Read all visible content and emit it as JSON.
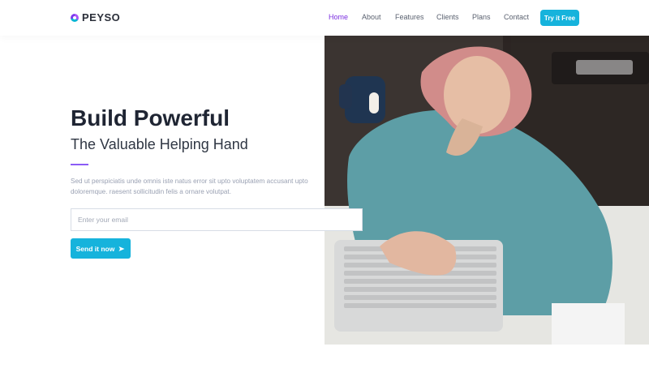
{
  "header": {
    "brand": "PEYSO",
    "nav": [
      {
        "label": "Home",
        "active": true
      },
      {
        "label": "About",
        "active": false
      },
      {
        "label": "Features",
        "active": false
      },
      {
        "label": "Clients",
        "active": false
      },
      {
        "label": "Plans",
        "active": false
      },
      {
        "label": "Contact",
        "active": false
      }
    ],
    "cta_label": "Try it Free"
  },
  "hero": {
    "title": "Build Powerful",
    "subtitle": "The Valuable Helping Hand",
    "description": "Sed ut perspiciatis unde omnis iste natus error sit upto voluptatem accusant upto doloremque. raesent sollicitudin felis a ornare volutpat.",
    "email_placeholder": "Enter your email",
    "email_value": "",
    "send_label": "Send it now"
  },
  "colors": {
    "accent": "#7b2fe0",
    "button": "#16b3dc",
    "divider": "#8b5cf6"
  },
  "icons": {
    "brand": "logo-mark-icon",
    "send": "send-icon"
  }
}
